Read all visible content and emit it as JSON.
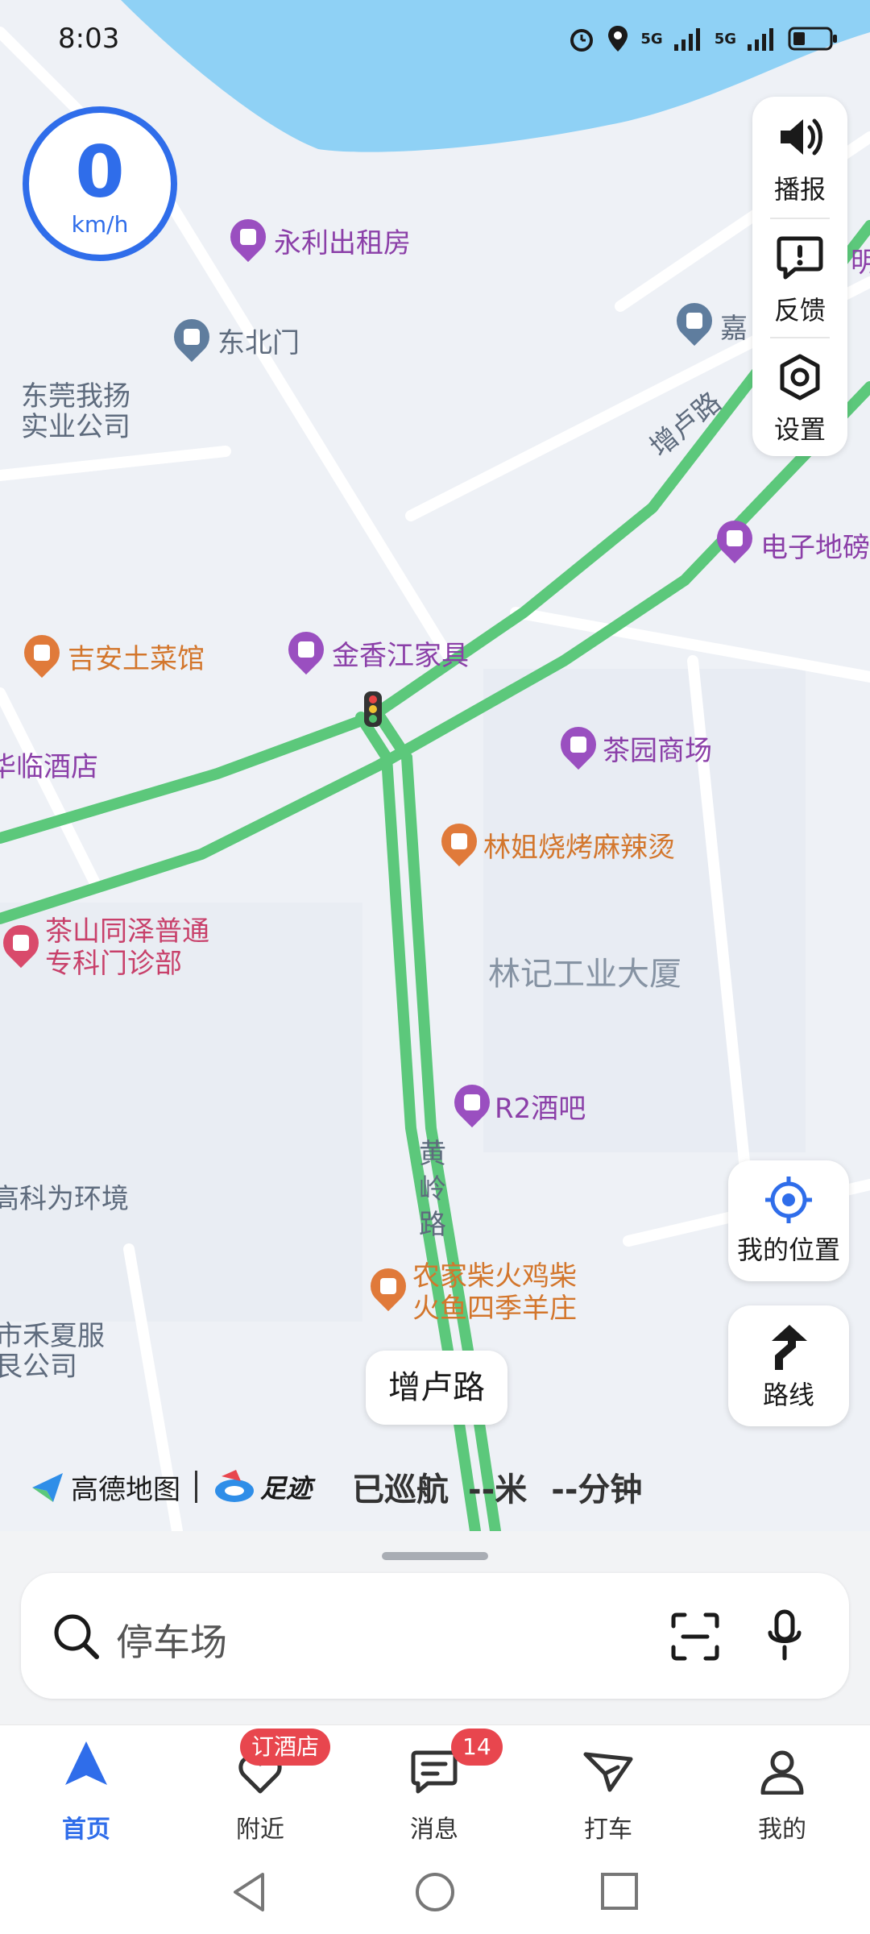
{
  "status": {
    "time": "8:03",
    "net1": "5G",
    "net2": "5G"
  },
  "speed": {
    "value": "0",
    "unit": "km/h"
  },
  "toolbar": {
    "broadcast": "播报",
    "feedback": "反馈",
    "settings": "设置"
  },
  "map": {
    "pois": [
      {
        "name": "永利出租房"
      },
      {
        "name": "东北门"
      },
      {
        "name": "东莞我扬"
      },
      {
        "name": "实业公司"
      },
      {
        "name": "嘉"
      },
      {
        "name": "明"
      },
      {
        "name": "电子地磅"
      },
      {
        "name": "吉安土菜馆"
      },
      {
        "name": "金香江家具"
      },
      {
        "name": "华临酒店"
      },
      {
        "name": "茶园商场"
      },
      {
        "name": "林姐烧烤麻辣烫"
      },
      {
        "name": "茶山同泽普通"
      },
      {
        "name": "专科门诊部"
      },
      {
        "name": "林记工业大厦"
      },
      {
        "name": "R2酒吧"
      },
      {
        "name": "高科为环境"
      },
      {
        "name": "农家柴火鸡柴"
      },
      {
        "name": "火鱼四季羊庄"
      },
      {
        "name": "市禾夏服"
      },
      {
        "name": "艮公司"
      }
    ],
    "roads": {
      "zenglu": "增卢路",
      "huangling": "黄岭路"
    }
  },
  "buttons": {
    "my_location": "我的位置",
    "route": "路线",
    "road_chip": "增卢路"
  },
  "attribution": {
    "brand1": "高德地图",
    "brand2": "足迹",
    "cruise": "已巡航",
    "dist": "--米",
    "time": "--分钟"
  },
  "search": {
    "placeholder": "停车场"
  },
  "nav": {
    "items": [
      {
        "label": "首页"
      },
      {
        "label": "附近",
        "badge": "订酒店"
      },
      {
        "label": "消息",
        "badge": "14"
      },
      {
        "label": "打车"
      },
      {
        "label": "我的"
      }
    ]
  },
  "colors": {
    "accent": "#2f6dea",
    "road": "#5cc87b",
    "water": "#8fd1f5",
    "badge": "#e8464e"
  }
}
